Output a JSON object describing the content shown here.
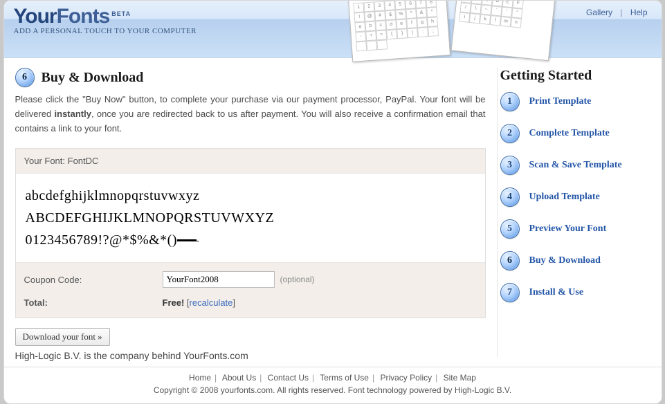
{
  "brand": {
    "your": "Your",
    "fonts": "Fonts",
    "beta": "BETA"
  },
  "tagline": "ADD A PERSONAL TOUCH TO YOUR COMPUTER",
  "nav": {
    "gallery": "Gallery",
    "help": "Help"
  },
  "page_title": {
    "num": "6",
    "text": "Buy & Download"
  },
  "intro": {
    "p1a": "Please click the \"Buy Now\" button, to complete your purchase via our payment processor, PayPal. Your font will be delivered ",
    "p1b": "instantly",
    "p1c": ", once you are redirected back to us after payment. You will also receive a confirmation email that contains a link to your font."
  },
  "panel": {
    "font_label": "Your Font: ",
    "font_name": "FontDC",
    "preview": {
      "lower": "abcdefghijklmnopqrstuvwxyz",
      "upper": "ABCDEFGHIJKLMNOPQRSTUVWXYZ",
      "symbols": "0123456789!?@*$%&*()"
    },
    "coupon_label": "Coupon Code:",
    "coupon_value": "YourFont2008",
    "optional": "(optional)",
    "total_label": "Total:",
    "total_value": "Free!",
    "recalculate": "recalculate"
  },
  "download_button": "Download your font »",
  "company_note": "High-Logic B.V. is the company behind YourFonts.com",
  "sidebar": {
    "title": "Getting Started",
    "steps": [
      {
        "n": "1",
        "label": "Print Template"
      },
      {
        "n": "2",
        "label": "Complete Template"
      },
      {
        "n": "3",
        "label": "Scan & Save Template"
      },
      {
        "n": "4",
        "label": "Upload Template"
      },
      {
        "n": "5",
        "label": "Preview Your Font"
      },
      {
        "n": "6",
        "label": "Buy & Download"
      },
      {
        "n": "7",
        "label": "Install & Use"
      }
    ]
  },
  "footer": {
    "links": [
      "Home",
      "About Us",
      "Contact Us",
      "Terms of Use",
      "Privacy Policy",
      "Site Map"
    ],
    "copyright": "Copyright © 2008 yourfonts.com. All rights reserved. Font technology powered by High-Logic B.V."
  }
}
